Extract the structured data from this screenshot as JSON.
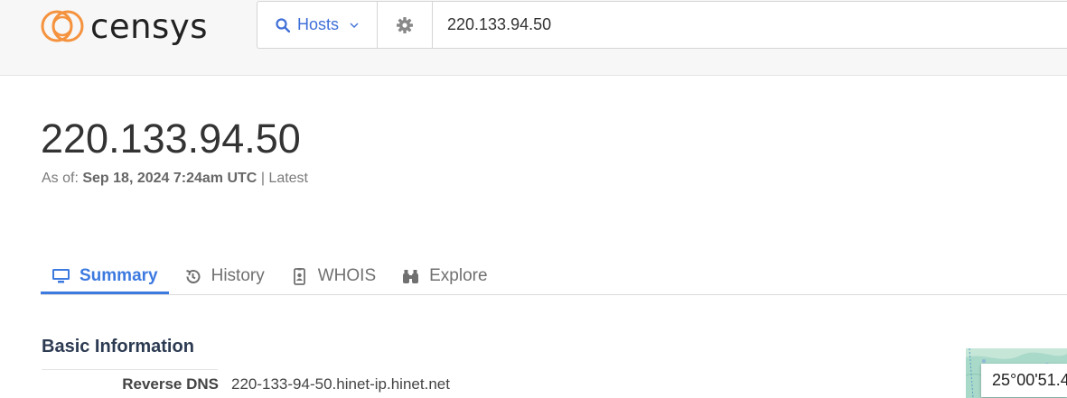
{
  "header": {
    "logo_text": "censys",
    "search_type": {
      "label": "Hosts",
      "icon": "search-icon"
    },
    "settings_icon": "gear-icon",
    "search_value": "220.133.94.50"
  },
  "colors": {
    "accent": "#3d7ae0",
    "logo_orange": "#f5923e",
    "header_bg": "#f7f7f7"
  },
  "page": {
    "title": "220.133.94.50",
    "asof_prefix": "As of:",
    "asof_timestamp": "Sep 18, 2024 7:24am UTC",
    "asof_suffix": "| Latest"
  },
  "tabs": [
    {
      "label": "Summary",
      "icon": "monitor-icon",
      "active": true
    },
    {
      "label": "History",
      "icon": "history-icon",
      "active": false
    },
    {
      "label": "WHOIS",
      "icon": "id-badge-icon",
      "active": false
    },
    {
      "label": "Explore",
      "icon": "binoculars-icon",
      "active": false
    }
  ],
  "basic_info": {
    "title": "Basic Information",
    "rows": [
      {
        "label": "Reverse DNS",
        "value": "220-133-94-50.hinet-ip.hinet.net"
      }
    ]
  },
  "map": {
    "coordinate": "25°00'51.4"
  }
}
